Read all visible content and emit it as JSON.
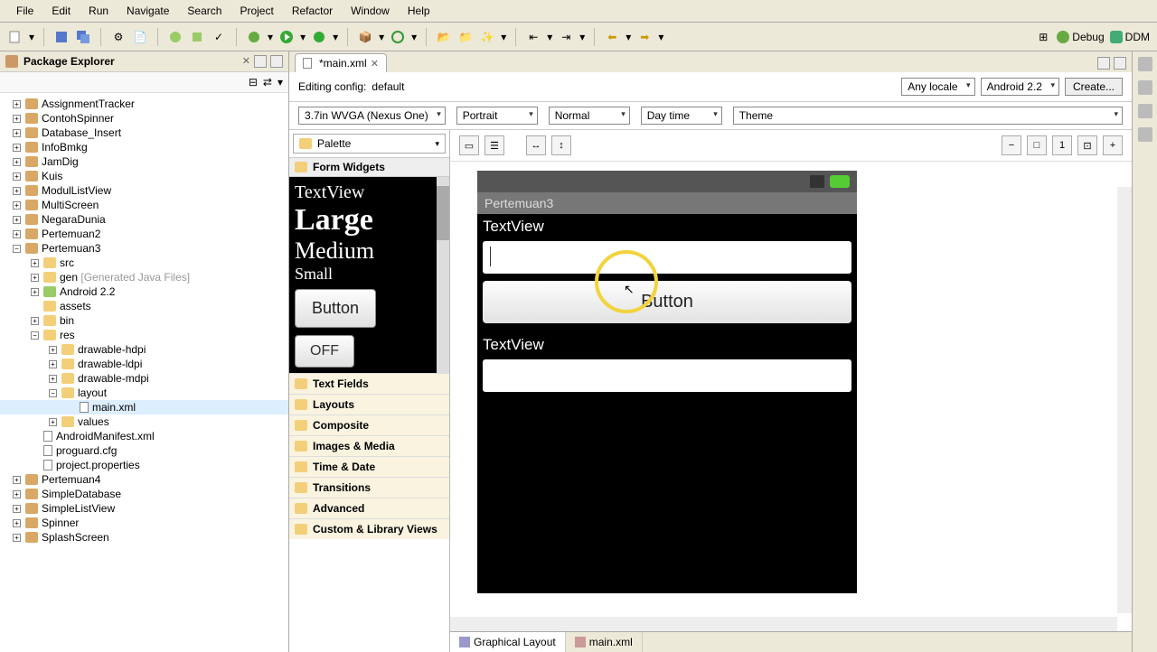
{
  "menu": [
    "File",
    "Edit",
    "Run",
    "Navigate",
    "Search",
    "Project",
    "Refactor",
    "Window",
    "Help"
  ],
  "debug_label": "Debug",
  "ddm_label": "DDM",
  "package_explorer_title": "Package Explorer",
  "projects": {
    "items": [
      "AssignmentTracker",
      "ContohSpinner",
      "Database_Insert",
      "InfoBmkg",
      "JamDig",
      "Kuis",
      "ModulListView",
      "MultiScreen",
      "NegaraDunia",
      "Pertemuan2"
    ],
    "open_project": "Pertemuan3",
    "open_children": {
      "src": "src",
      "gen": "gen",
      "gen_hint": "[Generated Java Files]",
      "android": "Android 2.2",
      "assets": "assets",
      "bin": "bin",
      "res": "res",
      "res_children": [
        "drawable-hdpi",
        "drawable-ldpi",
        "drawable-mdpi"
      ],
      "layout": "layout",
      "main_xml": "main.xml",
      "values": "values",
      "manifest": "AndroidManifest.xml",
      "proguard": "proguard.cfg",
      "props": "project.properties"
    },
    "after": [
      "Pertemuan4",
      "SimpleDatabase",
      "SimpleListView",
      "Spinner",
      "SplashScreen"
    ]
  },
  "editor_tab": "*main.xml",
  "config_label": "Editing config:",
  "config_value": "default",
  "locale": "Any locale",
  "target": "Android 2.2",
  "create_btn": "Create...",
  "device": "3.7in WVGA (Nexus One)",
  "orientation": "Portrait",
  "mode": "Normal",
  "time_mode": "Day time",
  "theme": "Theme",
  "palette_label": "Palette",
  "cat_formwidgets": "Form Widgets",
  "wp": {
    "tv": "TextView",
    "large": "Large",
    "medium": "Medium",
    "small": "Small",
    "button": "Button",
    "off": "OFF"
  },
  "categories": [
    "Text Fields",
    "Layouts",
    "Composite",
    "Images & Media",
    "Time & Date",
    "Transitions",
    "Advanced",
    "Custom & Library Views"
  ],
  "app_title": "Pertemuan3",
  "screen": {
    "tv1": "TextView",
    "button": "Button",
    "tv2": "TextView"
  },
  "bottom_tabs": {
    "graphical": "Graphical Layout",
    "xml": "main.xml"
  }
}
